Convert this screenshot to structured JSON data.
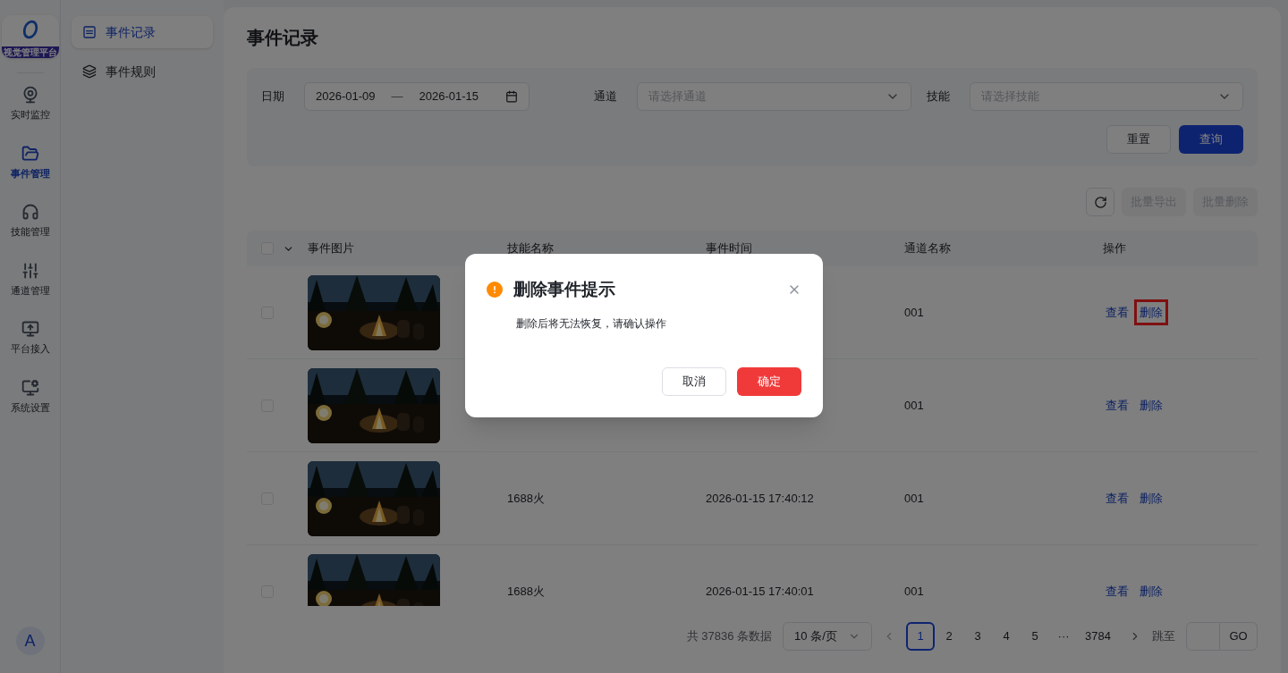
{
  "rail": {
    "logo_caption": "视觉管理平台",
    "items": [
      {
        "label": "实时监控",
        "selected": false
      },
      {
        "label": "事件管理",
        "selected": true
      },
      {
        "label": "技能管理",
        "selected": false
      },
      {
        "label": "通道管理",
        "selected": false
      },
      {
        "label": "平台接入",
        "selected": false
      },
      {
        "label": "系统设置",
        "selected": false
      }
    ],
    "avatar": "A"
  },
  "subnav": {
    "items": [
      {
        "label": "事件记录",
        "selected": true
      },
      {
        "label": "事件规则",
        "selected": false
      }
    ]
  },
  "page_title": "事件记录",
  "filters": {
    "date_label": "日期",
    "date_start": "2026-01-09",
    "date_separator": "—",
    "date_end": "2026-01-15",
    "channel_label": "通道",
    "channel_placeholder": "请选择通道",
    "skill_label": "技能",
    "skill_placeholder": "请选择技能",
    "reset": "重置",
    "query": "查询"
  },
  "toolbar": {
    "buttons": [
      {
        "label": "批量导出",
        "disabled": true
      },
      {
        "label": "批量删除",
        "disabled": true
      }
    ]
  },
  "table": {
    "select_all_checked": false,
    "columns": [
      "事件图片",
      "技能名称",
      "事件时间",
      "通道名称",
      "操作"
    ],
    "rows": [
      {
        "checked": false,
        "channel": "001",
        "actions": [
          {
            "label": "查看",
            "highlighted": false
          },
          {
            "label": "删除",
            "highlighted": true
          }
        ]
      },
      {
        "checked": false,
        "channel": "001",
        "actions": [
          {
            "label": "查看",
            "highlighted": false
          },
          {
            "label": "删除",
            "highlighted": false
          }
        ]
      },
      {
        "checked": false,
        "skill": "1688火",
        "time": "2026-01-15 17:40:12",
        "channel": "001",
        "actions": [
          {
            "label": "查看",
            "highlighted": false
          },
          {
            "label": "删除",
            "highlighted": false
          }
        ]
      },
      {
        "checked": false,
        "skill": "1688火",
        "time": "2026-01-15 17:40:01",
        "channel": "001",
        "actions": [
          {
            "label": "查看",
            "highlighted": false
          },
          {
            "label": "删除",
            "highlighted": false
          }
        ]
      }
    ]
  },
  "pagination": {
    "total": "共 37836 条数据",
    "page_size": "10 条/页",
    "pages": [
      {
        "label": "1",
        "selected": true
      },
      {
        "label": "2",
        "selected": false
      },
      {
        "label": "3",
        "selected": false
      },
      {
        "label": "4",
        "selected": false
      },
      {
        "label": "5",
        "selected": false
      },
      {
        "label": "···",
        "selected": false
      },
      {
        "label": "3784",
        "selected": false
      }
    ],
    "jump_label": "跳至",
    "go": "GO"
  },
  "dialog": {
    "title": "删除事件提示",
    "message": "删除后将无法恢复，请确认操作",
    "cancel": "取消",
    "confirm": "确定"
  }
}
